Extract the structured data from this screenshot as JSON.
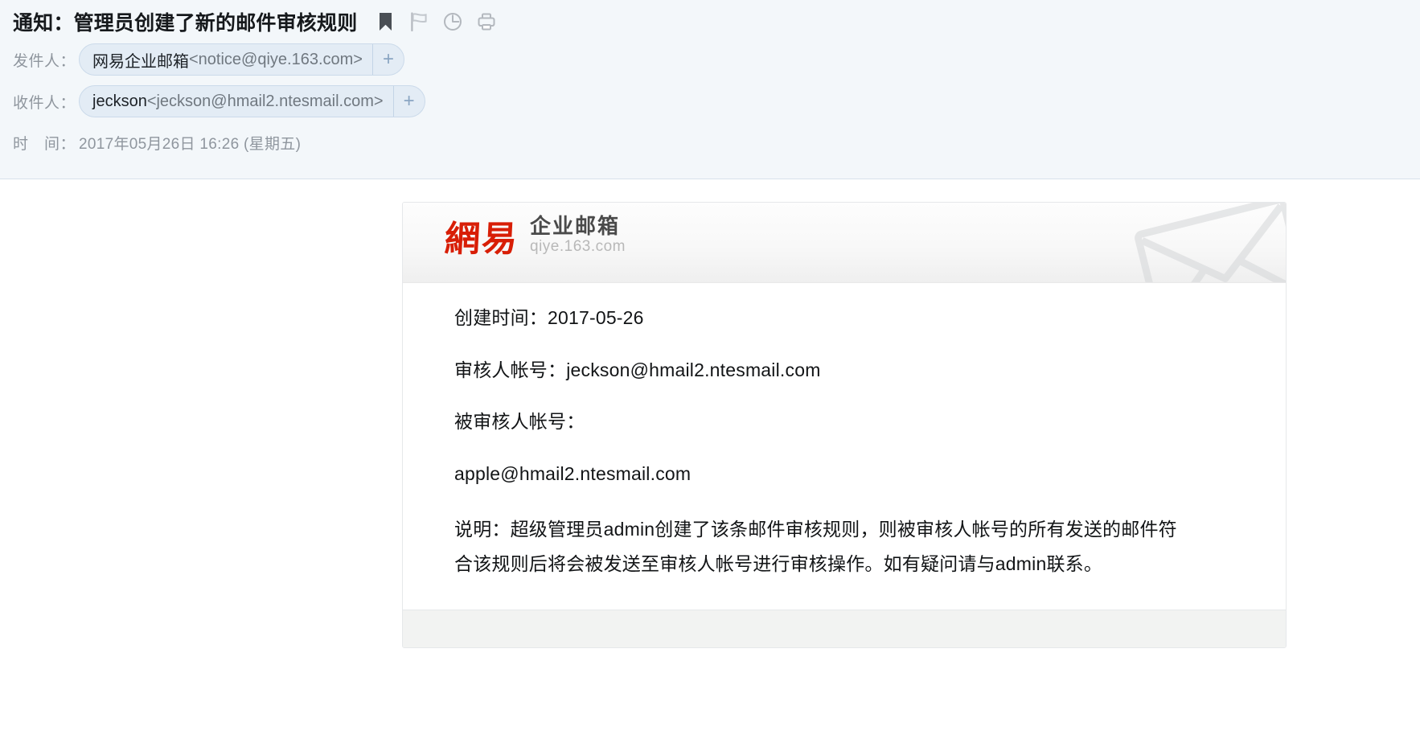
{
  "header": {
    "subject": "通知：管理员创建了新的邮件审核规则",
    "icons": [
      {
        "name": "bookmark-icon",
        "state": "active"
      },
      {
        "name": "flag-icon",
        "state": "inactive"
      },
      {
        "name": "clock-icon",
        "state": "inactive"
      },
      {
        "name": "print-icon",
        "state": "inactive"
      }
    ],
    "from": {
      "label": "发件人：",
      "name": "网易企业邮箱",
      "email": "<notice@qiye.163.com>",
      "add_label": "+"
    },
    "to": {
      "label": "收件人：",
      "name": "jeckson",
      "email": "<jeckson@hmail2.ntesmail.com>",
      "add_label": "+"
    },
    "time": {
      "label": "时　间：",
      "value": "2017年05月26日 16:26 (星期五)"
    }
  },
  "card": {
    "brand": {
      "logo_cn": "網易",
      "title": "企业邮箱",
      "url": "qiye.163.com",
      "logo_color": "#d81e06",
      "watermark": "envelope-watermark"
    },
    "lines": [
      "创建时间：2017-05-26",
      "审核人帐号：jeckson@hmail2.ntesmail.com",
      "被审核人帐号：",
      "apple@hmail2.ntesmail.com"
    ],
    "description": "说明：超级管理员admin创建了该条邮件审核规则，则被审核人帐号的所有发送的邮件符合该规则后将会被发送至审核人帐号进行审核操作。如有疑问请与admin联系。"
  },
  "colors": {
    "header_bg": "#f3f7fa",
    "chip_bg": "#e3ecf5",
    "chip_border": "#cbdaea",
    "meta_text": "#8f969e",
    "body_text": "#121416",
    "footer_bg": "#f2f3f2"
  }
}
